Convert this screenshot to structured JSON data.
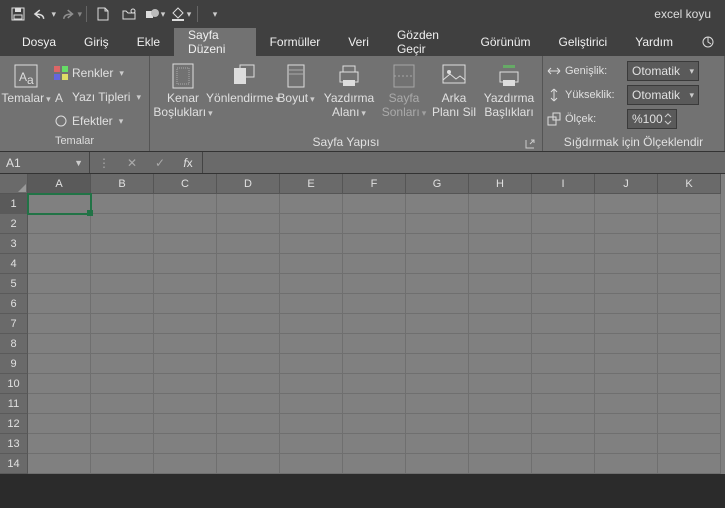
{
  "qat": {
    "title": "excel koyu"
  },
  "tabs": {
    "file": "Dosya",
    "home": "Giriş",
    "insert": "Ekle",
    "pageLayout": "Sayfa Düzeni",
    "formulas": "Formüller",
    "data": "Veri",
    "review": "Gözden Geçir",
    "view": "Görünüm",
    "developer": "Geliştirici",
    "help": "Yardım"
  },
  "ribbon": {
    "themes": {
      "main": "Temalar",
      "colors": "Renkler",
      "fonts": "Yazı Tipleri",
      "effects": "Efektler",
      "group": "Temalar"
    },
    "pageSetup": {
      "margins": "Kenar\nBoşlukları",
      "orientation": "Yönlendirme",
      "size": "Boyut",
      "printArea": "Yazdırma\nAlanı",
      "breaks": "Sayfa\nSonları",
      "background": "Arka\nPlanı Sil",
      "printTitles": "Yazdırma\nBaşlıkları",
      "group": "Sayfa Yapısı"
    },
    "scale": {
      "widthLbl": "Genişlik:",
      "widthVal": "Otomatik",
      "heightLbl": "Yükseklik:",
      "heightVal": "Otomatik",
      "scaleLbl": "Ölçek:",
      "scaleVal": "%100",
      "group": "Sığdırmak için Ölçeklendir"
    }
  },
  "formulaBar": {
    "nameBox": "A1"
  },
  "grid": {
    "cols": [
      "A",
      "B",
      "C",
      "D",
      "E",
      "F",
      "G",
      "H",
      "I",
      "J",
      "K"
    ],
    "rows": [
      "1",
      "2",
      "3",
      "4",
      "5",
      "6",
      "7",
      "8",
      "9",
      "10",
      "11",
      "12",
      "13",
      "14"
    ]
  }
}
